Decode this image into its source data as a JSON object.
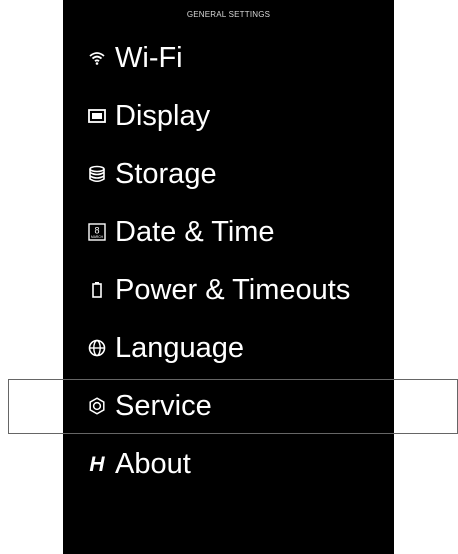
{
  "header": {
    "title": "GENERAL SETTINGS"
  },
  "menu": {
    "items": [
      {
        "label": "Wi-Fi",
        "icon": "wifi-icon"
      },
      {
        "label": "Display",
        "icon": "display-icon"
      },
      {
        "label": "Storage",
        "icon": "storage-icon"
      },
      {
        "label": "Date & Time",
        "icon": "calendar-icon",
        "icon_text": "8",
        "icon_subtext": "MARCH"
      },
      {
        "label": "Power & Timeouts",
        "icon": "battery-icon"
      },
      {
        "label": "Language",
        "icon": "globe-icon"
      },
      {
        "label": "Service",
        "icon": "service-nut-icon",
        "selected": true
      },
      {
        "label": "About",
        "icon": "brand-h-icon",
        "icon_text": "H"
      }
    ]
  },
  "colors": {
    "background": "#000000",
    "text": "#ffffff",
    "selection_border": "#666666"
  }
}
